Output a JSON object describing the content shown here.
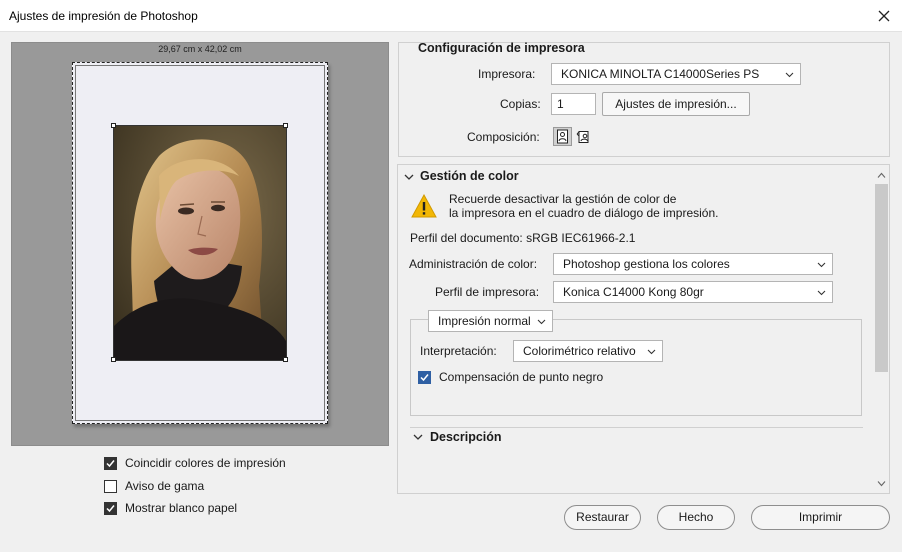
{
  "window": {
    "title": "Ajustes de impresión de Photoshop"
  },
  "preview": {
    "paper_size": "29,67 cm x 42,02 cm"
  },
  "left_options": [
    {
      "label": "Coincidir colores de impresión",
      "checked": true
    },
    {
      "label": "Aviso de gama",
      "checked": false
    },
    {
      "label": "Mostrar blanco papel",
      "checked": true
    }
  ],
  "printer_setup": {
    "title": "Configuración de impresora",
    "printer_label": "Impresora:",
    "printer_value": "KONICA MINOLTA C14000Series PS",
    "copies_label": "Copias:",
    "copies_value": "1",
    "print_settings_button": "Ajustes de impresión...",
    "layout_label": "Composición:"
  },
  "color_management": {
    "title": "Gestión de color",
    "warning_line1": "Recuerde desactivar la gestión de color de",
    "warning_line2": "la impresora en el cuadro de diálogo de impresión.",
    "document_profile": "Perfil del documento: sRGB IEC61966-2.1",
    "color_handling_label": "Administración de color:",
    "color_handling_value": "Photoshop gestiona los colores",
    "printer_profile_label": "Perfil de impresora:",
    "printer_profile_value": "Konica C14000 Kong 80gr",
    "print_mode": "Impresión normal",
    "rendering_intent_label": "Interpretación:",
    "rendering_intent_value": "Colorimétrico relativo",
    "black_point_label": "Compensación de punto negro",
    "black_point_checked": true
  },
  "description": {
    "title": "Descripción"
  },
  "buttons": {
    "reset": "Restaurar",
    "done": "Hecho",
    "print": "Imprimir"
  },
  "colors": {
    "warning": "#f2b705",
    "preview_bg": "#999999",
    "paper": "#eeeef4"
  }
}
